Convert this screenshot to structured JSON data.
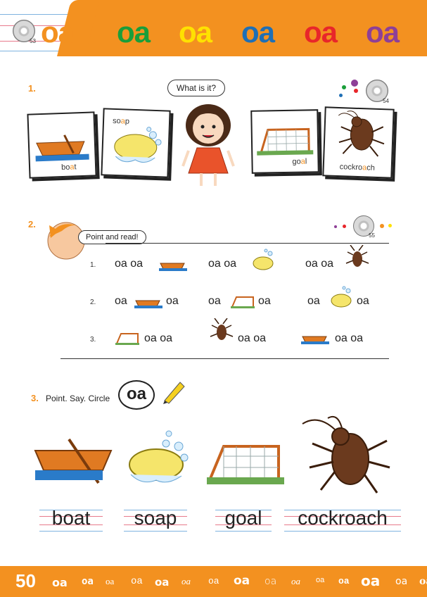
{
  "header": {
    "cd_number": "53",
    "title": "oa",
    "colored_words": [
      {
        "text": "oa",
        "color": "#1a9e3a"
      },
      {
        "text": "oa",
        "color": "#ffe100"
      },
      {
        "text": "oa",
        "color": "#1f6fb5"
      },
      {
        "text": "oa",
        "color": "#e8262a"
      },
      {
        "text": "oa",
        "color": "#8e3f97"
      }
    ]
  },
  "section1": {
    "number": "1.",
    "speech": "What is it?",
    "cd_number": "54",
    "cards": [
      {
        "pre": "bo",
        "hl": "a",
        "post": "t",
        "icon": "boat-icon"
      },
      {
        "pre": "so",
        "hl": "a",
        "post": "p",
        "icon": "soap-icon"
      },
      {
        "pre": "go",
        "hl": "a",
        "post": "l",
        "icon": "goal-icon"
      },
      {
        "pre": "cockro",
        "hl": "a",
        "post": "ch",
        "icon": "cockroach-icon"
      }
    ]
  },
  "section2": {
    "number": "2.",
    "speech": "Point and read!",
    "cd_number": "55",
    "rows": [
      {
        "num": "1.",
        "text_a": "oa oa",
        "text_b": "oa oa",
        "text_c": "oa oa"
      },
      {
        "num": "2.",
        "text": "oa"
      },
      {
        "num": "3.",
        "text_a": "oa oa",
        "text_b": "oa oa",
        "text_c": "oa oa"
      }
    ]
  },
  "section3": {
    "number": "3.",
    "instruction": "Point. Say. Circle",
    "circle_text": "oa",
    "words": [
      "boat",
      "soap",
      "goal",
      "cockroach"
    ]
  },
  "footer": {
    "page_number": "50",
    "sequence": [
      "oa",
      "oa",
      "oa",
      "oa",
      "oa",
      "oa",
      "oa",
      "oa",
      "oa",
      "oa",
      "oa",
      "oa",
      "oa",
      "oa",
      "oa"
    ]
  },
  "colors": {
    "orange": "#f39120",
    "blue_line": "#7fb3e0",
    "red_line": "#e87a8c",
    "water": "#2a7bc9"
  }
}
